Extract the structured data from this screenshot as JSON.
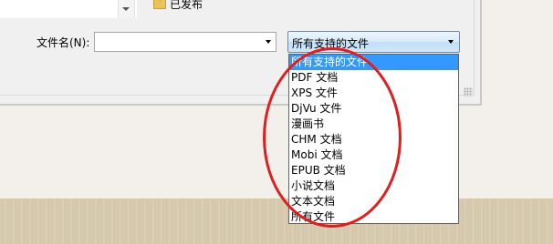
{
  "tree": {
    "folder_label": "已发布"
  },
  "file_name": {
    "label": "文件名(N):",
    "value": ""
  },
  "file_type": {
    "selected": "所有支持的文件",
    "options": [
      "所有支持的文件",
      "PDF 文档",
      "XPS 文件",
      "DjVu 文件",
      "漫画书",
      "CHM 文档",
      "Mobi 文档",
      "EPUB 文档",
      "小说文档",
      "文本文档",
      "所有文件"
    ]
  },
  "annotation": {
    "color": "#e01e1e"
  }
}
